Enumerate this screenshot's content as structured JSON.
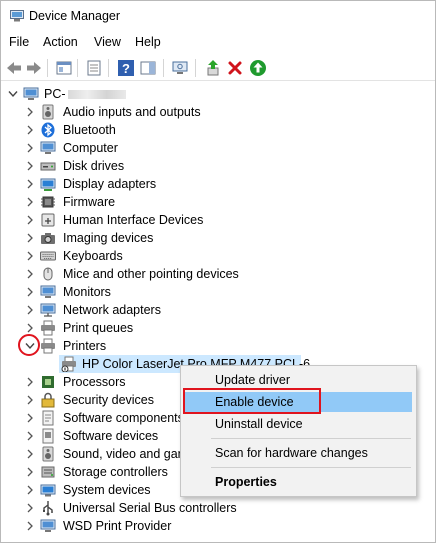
{
  "window": {
    "title": "Device Manager"
  },
  "menu": [
    "File",
    "Action",
    "View",
    "Help"
  ],
  "tree": {
    "root_label": "PC-",
    "categories": [
      "Audio inputs and outputs",
      "Bluetooth",
      "Computer",
      "Disk drives",
      "Display adapters",
      "Firmware",
      "Human Interface Devices",
      "Imaging devices",
      "Keyboards",
      "Mice and other pointing devices",
      "Monitors",
      "Network adapters",
      "Print queues",
      "Printers",
      "Processors",
      "Security devices",
      "Software components",
      "Software devices",
      "Sound, video and game controllers",
      "Storage controllers",
      "System devices",
      "Universal Serial Bus controllers",
      "WSD Print Provider"
    ],
    "printer_child": "HP Color LaserJet Pro MFP M477 PCL-6",
    "truncated": {
      "software_components": "Software components",
      "sound": "Sound, video and gam"
    }
  },
  "context_menu": {
    "update": "Update driver",
    "enable": "Enable device",
    "uninstall": "Uninstall device",
    "scan": "Scan for hardware changes",
    "properties": "Properties"
  },
  "colors": {
    "annotation": "#e0141e",
    "menu_highlight": "#91c9f7",
    "selection": "#cce8ff"
  }
}
